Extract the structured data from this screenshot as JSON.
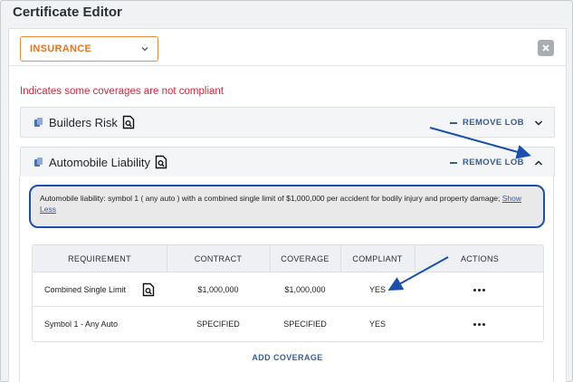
{
  "window": {
    "title": "Certificate Editor"
  },
  "type_select": {
    "value": "INSURANCE"
  },
  "warning": "Indicates some coverages are not compliant",
  "lobs": [
    {
      "name": "Builders Risk",
      "remove_label": "REMOVE LOB",
      "expanded": false
    },
    {
      "name": "Automobile Liability",
      "remove_label": "REMOVE LOB",
      "expanded": true
    }
  ],
  "auto_liability": {
    "description": "Automobile liability: symbol 1 ( any auto ) with a combined single limit of $1,000,000 per accident for bodily injury and property damage;",
    "show_less_label": "Show Less",
    "table": {
      "headers": [
        "REQUIREMENT",
        "CONTRACT",
        "COVERAGE",
        "COMPLIANT",
        "ACTIONS"
      ],
      "rows": [
        {
          "requirement": "Combined Single Limit",
          "contract": "$1,000,000",
          "coverage": "$1,000,000",
          "compliant": "YES"
        },
        {
          "requirement": "Symbol 1 - Any Auto",
          "contract": "SPECIFIED",
          "coverage": "SPECIFIED",
          "compliant": "YES"
        }
      ]
    },
    "add_coverage_label": "ADD COVERAGE"
  },
  "colors": {
    "accent_orange": "#e9731f",
    "link_blue": "#375b94",
    "annotation_blue": "#1a4fae",
    "warning_red": "#d3263c"
  },
  "icons": [
    "chevron-down-icon",
    "close-icon",
    "copy-doc-icon",
    "search-document-icon",
    "chevron-up-icon",
    "more-actions-icon"
  ]
}
